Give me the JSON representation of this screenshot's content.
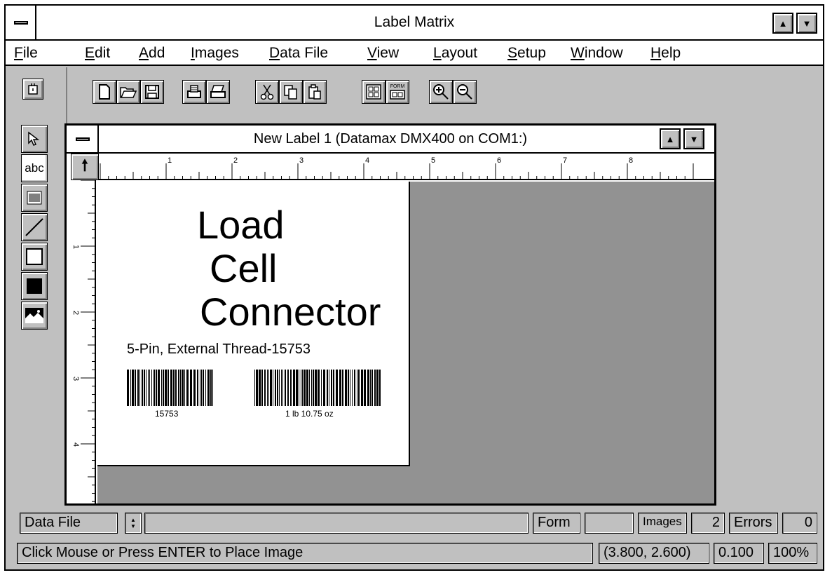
{
  "app": {
    "title": "Label Matrix"
  },
  "menu": [
    {
      "pre": "",
      "u": "F",
      "post": "ile"
    },
    {
      "pre": "",
      "u": "E",
      "post": "dit"
    },
    {
      "pre": "",
      "u": "A",
      "post": "dd"
    },
    {
      "pre": "",
      "u": "I",
      "post": "mages"
    },
    {
      "pre": "",
      "u": "D",
      "post": "ata File"
    },
    {
      "pre": "",
      "u": "V",
      "post": "iew"
    },
    {
      "pre": "",
      "u": "L",
      "post": "ayout"
    },
    {
      "pre": "",
      "u": "S",
      "post": "etup"
    },
    {
      "pre": "",
      "u": "W",
      "post": "indow"
    },
    {
      "pre": "",
      "u": "H",
      "post": "elp"
    }
  ],
  "toolbar": {
    "icons": [
      "new-file-icon",
      "open-folder-icon",
      "save-icon",
      "print-preview-icon",
      "print-icon",
      "cut-icon",
      "copy-icon",
      "paste-icon",
      "grid-layout-icon",
      "form-icon",
      "zoom-in-icon",
      "zoom-out-icon"
    ],
    "form_small_label": "FORM"
  },
  "tools": {
    "text_label": "abc",
    "icons": [
      "pointer-icon",
      "text-tool-icon",
      "barcode-tool-icon",
      "line-tool-icon",
      "rectangle-tool-icon",
      "filled-rectangle-tool-icon",
      "image-tool-icon"
    ]
  },
  "document": {
    "title": "New Label 1 (Datamax DMX400 on COM1:)",
    "ruler_top_numbers": [
      "1",
      "2",
      "3",
      "4",
      "5",
      "6",
      "7",
      "8"
    ],
    "ruler_left_numbers": [
      "1",
      "2",
      "3",
      "4"
    ],
    "label": {
      "line1": "Load",
      "line2": "Cell",
      "line3": "Connector",
      "description": "5-Pin, External Thread-15753",
      "barcode1_text": "15753",
      "barcode2_text": "1 lb 10.75 oz"
    }
  },
  "status": {
    "data_file_label": "Data File",
    "form_label": "Form",
    "form_value": "",
    "images_label": "Images",
    "images_value": "2",
    "errors_label": "Errors",
    "errors_value": "0",
    "message": "Click Mouse or Press ENTER to Place Image",
    "coords": "(3.800, 2.600)",
    "grid": "0.100",
    "zoom": "100%"
  }
}
